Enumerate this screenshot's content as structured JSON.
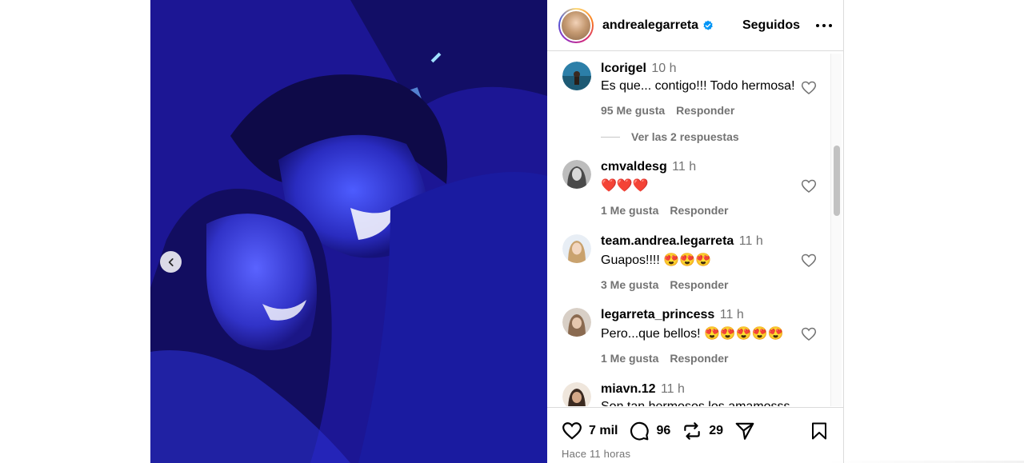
{
  "post": {
    "username": "andrealegarreta",
    "follow_status": "Seguidos",
    "likes": "7 mil",
    "comments_count": "96",
    "reposts": "29",
    "posted_time": "Hace 11 horas"
  },
  "comments": [
    {
      "user": "lcorigel",
      "time": "10 h",
      "text": "Es que... contigo!!! Todo hermosa!",
      "likes": "95 Me gusta",
      "reply": "Responder"
    },
    {
      "user": "cmvaldesg",
      "time": "11 h",
      "text": "❤️❤️❤️",
      "likes": "1 Me gusta",
      "reply": "Responder"
    },
    {
      "user": "team.andrea.legarreta",
      "time": "11 h",
      "text": "Guapos!!!! 😍😍😍",
      "likes": "3 Me gusta",
      "reply": "Responder"
    },
    {
      "user": "legarreta_princess",
      "time": "11 h",
      "text": "Pero...que bellos! 😍😍😍😍😍",
      "likes": "1 Me gusta",
      "reply": "Responder"
    },
    {
      "user": "miavn.12",
      "time": "11 h",
      "text": "Son tan hermosos los amamosss"
    }
  ],
  "view_replies": "Ver las 2 respuestas",
  "colors": {
    "verified": "#0095f6",
    "secondary_text": "#737373",
    "border": "#dbdbdb"
  },
  "icons": [
    "chevron-left-icon",
    "verified-badge-icon",
    "more-icon",
    "heart-icon",
    "comment-icon",
    "repost-icon",
    "share-icon",
    "bookmark-icon"
  ]
}
